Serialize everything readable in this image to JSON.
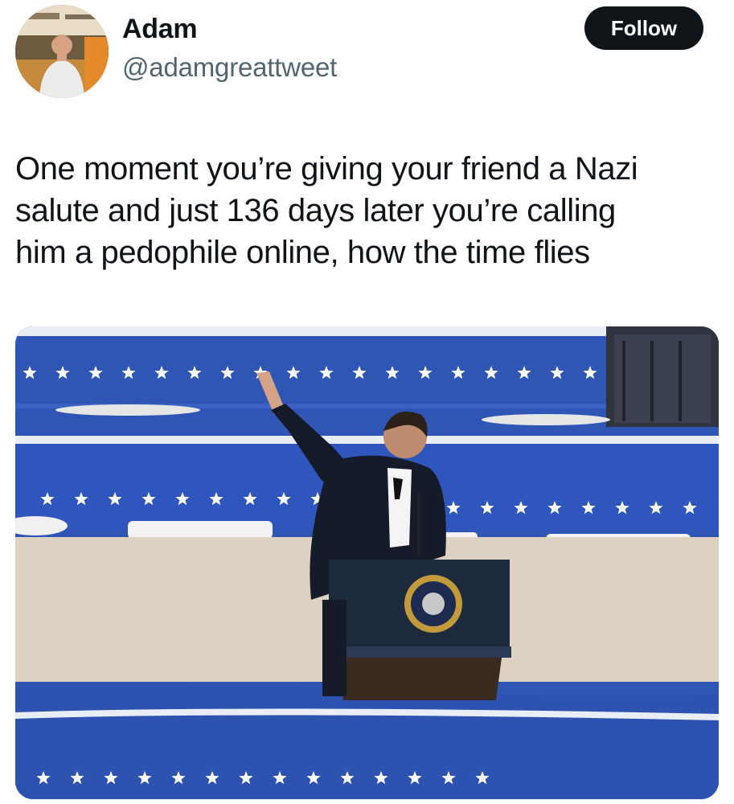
{
  "author": {
    "display_name": "Adam",
    "handle": "@adamgreattweet",
    "avatar_icon": "user-avatar-photo"
  },
  "actions": {
    "follow_label": "Follow"
  },
  "tweet": {
    "text": "One moment you’re giving your friend a Nazi\nsalute and just 136 days later you’re calling\nhim a pedophile online, how the time flies"
  },
  "media": {
    "icon": "attached-photo",
    "colors": {
      "banner_blue": "#2f55b5",
      "star_white": "#ffffff",
      "wall_beige": "#ddd2c2",
      "podium_navy": "#1d2a3e"
    }
  },
  "colors": {
    "text_primary": "#0f1419",
    "text_secondary": "#536471",
    "button_bg": "#0f1419",
    "button_text": "#ffffff"
  }
}
